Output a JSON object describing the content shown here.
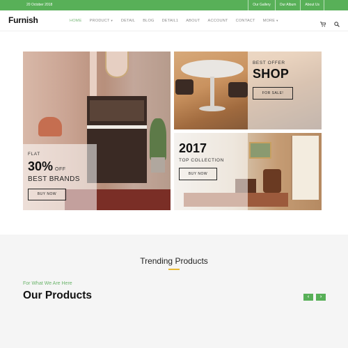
{
  "topbar": {
    "date": "20 October 2018",
    "links": [
      "Our Gallery",
      "Our Album",
      "About Us"
    ]
  },
  "nav": {
    "logo": "Furnish",
    "items": [
      "HOME",
      "PRODUCT",
      "DETAIL",
      "BLOG",
      "DETAIL1",
      "ABOUT",
      "ACCOUNT",
      "CONTACT",
      "MORE"
    ],
    "active": "HOME",
    "icons": [
      "cart-icon",
      "search-icon"
    ]
  },
  "banners": {
    "left": {
      "flat": "FLAT",
      "percent": "30%",
      "off": "OFF",
      "brands": "BEST BRANDS",
      "button": "BUY NOW"
    },
    "top_right": {
      "best_offer": "BEST OFFER",
      "shop": "SHOP",
      "button": "FOR SALE!"
    },
    "bottom_right": {
      "year": "2017",
      "collection": "TOP COLLECTION",
      "button": "BUY NOW"
    }
  },
  "products": {
    "section_title": "Trending Products",
    "subtitle": "For What We Are Here",
    "heading": "Our Products",
    "prev": "‹",
    "next": "›"
  },
  "colors": {
    "accent": "#58b058",
    "underline": "#e8b830"
  }
}
